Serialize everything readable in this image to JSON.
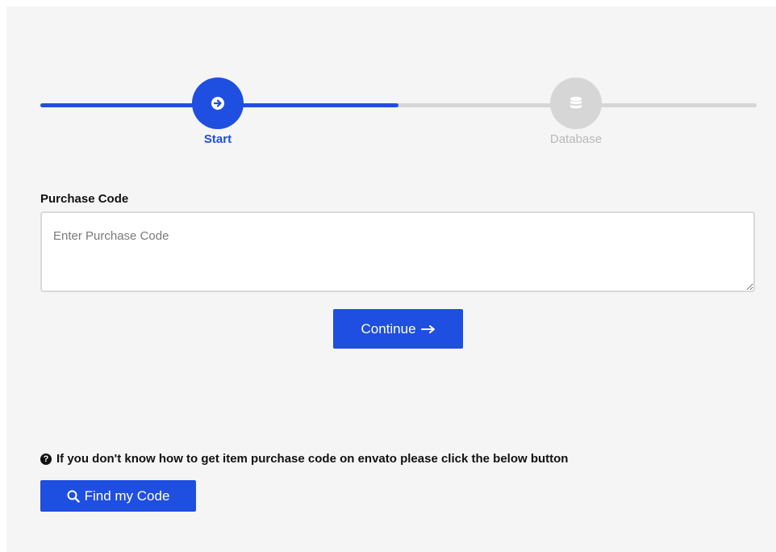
{
  "stepper": {
    "progress_fraction": 0.5,
    "steps": [
      {
        "label": "Start",
        "icon": "arrow-right-circle-icon",
        "state": "active"
      },
      {
        "label": "Database",
        "icon": "database-icon",
        "state": "inactive"
      }
    ]
  },
  "form": {
    "label": "Purchase Code",
    "placeholder": "Enter Purchase Code",
    "value": ""
  },
  "continue_button": {
    "label": "Continue",
    "icon": "arrow-right-icon"
  },
  "help": {
    "icon": "question-circle-icon",
    "text": "If you don't know how to get item purchase code on envato please click the below button"
  },
  "find_button": {
    "label": "Find my Code",
    "icon": "search-icon"
  },
  "colors": {
    "accent": "#1f4fe0",
    "inactive": "#d6d6d6",
    "panel_bg": "#f5f5f6"
  }
}
